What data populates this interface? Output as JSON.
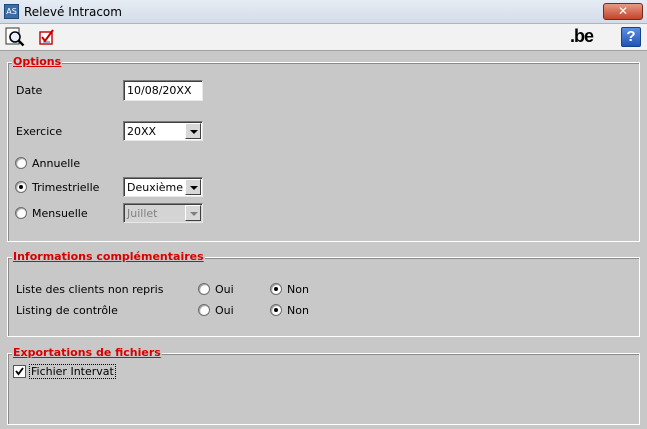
{
  "window": {
    "title": "Relevé Intracom",
    "app_icon_text": "AS",
    "close_label": "✕"
  },
  "toolbar": {
    "preview_icon": "magnifier-page-icon",
    "validate_icon": "checklist-icon",
    "logo_text": ".be",
    "help_label": "?"
  },
  "options": {
    "title": "Options",
    "date_label": "Date",
    "date_value": "10/08/20XX",
    "exercice_label": "Exercice",
    "exercice_value": "20XX",
    "period_annual_label": "Annuelle",
    "period_quarterly_label": "Trimestrielle",
    "period_monthly_label": "Mensuelle",
    "selected_period": "Trimestrielle",
    "quarter_value": "Deuxième",
    "month_value": "Juillet"
  },
  "info": {
    "title": "Informations complémentaires",
    "clients_label": "Liste des clients non repris",
    "control_label": "Listing de contrôle",
    "yes_label": "Oui",
    "no_label": "Non",
    "clients_selected": "Non",
    "control_selected": "Non"
  },
  "exports": {
    "title": "Exportations de fichiers",
    "intervat_label": "Fichier Intervat",
    "intervat_checked": true
  }
}
